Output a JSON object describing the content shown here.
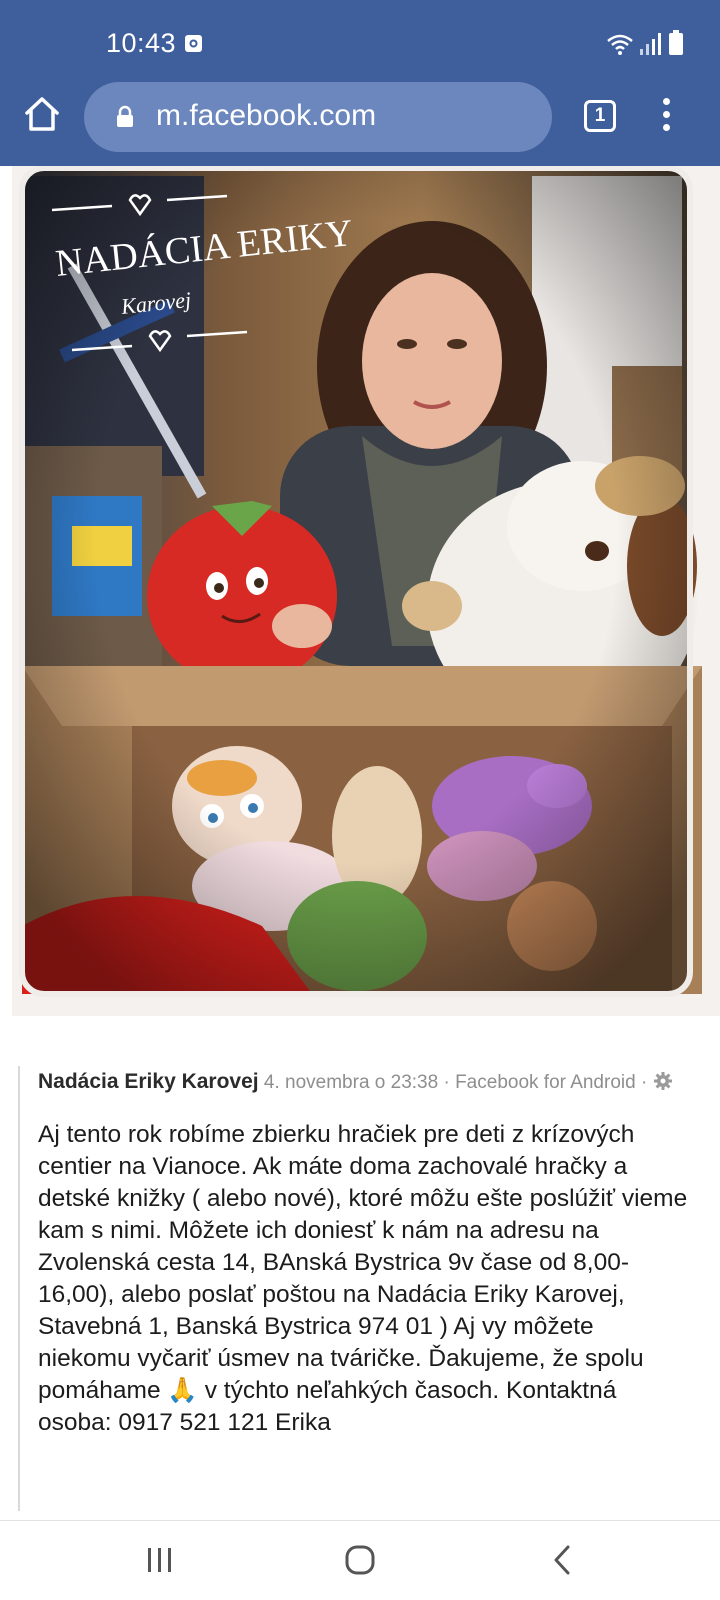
{
  "status_bar": {
    "time": "10:43",
    "icons": [
      "screenshot-notification-icon",
      "wifi-icon",
      "signal-icon",
      "battery-icon"
    ]
  },
  "browser": {
    "url": "m.facebook.com",
    "tab_count": "1",
    "icons": [
      "home-icon",
      "lock-icon",
      "tabs-icon",
      "more-vert-icon"
    ]
  },
  "photo": {
    "watermark_logo_text": "NADÁCIA ERIKY Karovej",
    "description": "Woman holding plush toys above a cardboard box of donated toys"
  },
  "post": {
    "author": "Nadácia Eriky Karovej",
    "meta": " 4. novembra o 23:38 · Facebook for Android · ",
    "body_part1": "Aj tento rok robíme zbierku hračiek pre deti z krízových centier na Vianoce. Ak máte doma zachovalé hračky a detské knižky ( alebo nové), ktoré môžu ešte poslúžiť vieme kam s nimi. Môžete ich doniesť k nám na adresu na Zvolenská cesta 14, BAnská Bystrica 9v čase od 8,00-16,00), alebo poslať poštou na Nadácia Eriky Karovej, Stavebná 1, Banská Bystrica 974 01 ) Aj vy môžete niekomu vyčariť úsmev na tváričke. Ďakujeme, že spolu pomáhame ",
    "emoji": "🙏",
    "body_part2": " v týchto neľahkých časoch. Kontaktná osoba: 0917 521 121 Erika"
  },
  "navigation": {
    "buttons": [
      "recents-icon",
      "home-icon",
      "back-icon"
    ]
  },
  "colors": {
    "browser_bar": "#3f5f9c",
    "url_pill": "#6b87bd",
    "text_primary": "#1c1c1c",
    "text_meta": "#8e8e8e"
  }
}
